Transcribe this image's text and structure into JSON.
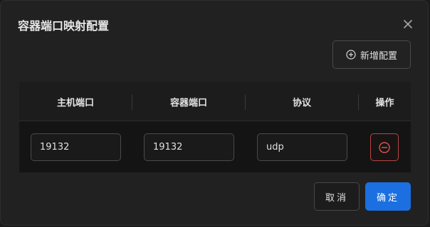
{
  "dialog": {
    "title": "容器端口映射配置",
    "close_icon": "close-icon"
  },
  "toolbar": {
    "add_label": "新增配置",
    "add_icon": "plus-circle-icon"
  },
  "table": {
    "headers": [
      "主机端口",
      "容器端口",
      "协议",
      "操作"
    ],
    "rows": [
      {
        "host_port": "19132",
        "container_port": "19132",
        "protocol": "udp",
        "action_icon": "minus-circle-icon"
      }
    ]
  },
  "footer": {
    "cancel_label": "取消",
    "ok_label": "确定"
  },
  "colors": {
    "accent": "#1b6fe0",
    "danger": "#d9534f",
    "background": "#212121"
  }
}
